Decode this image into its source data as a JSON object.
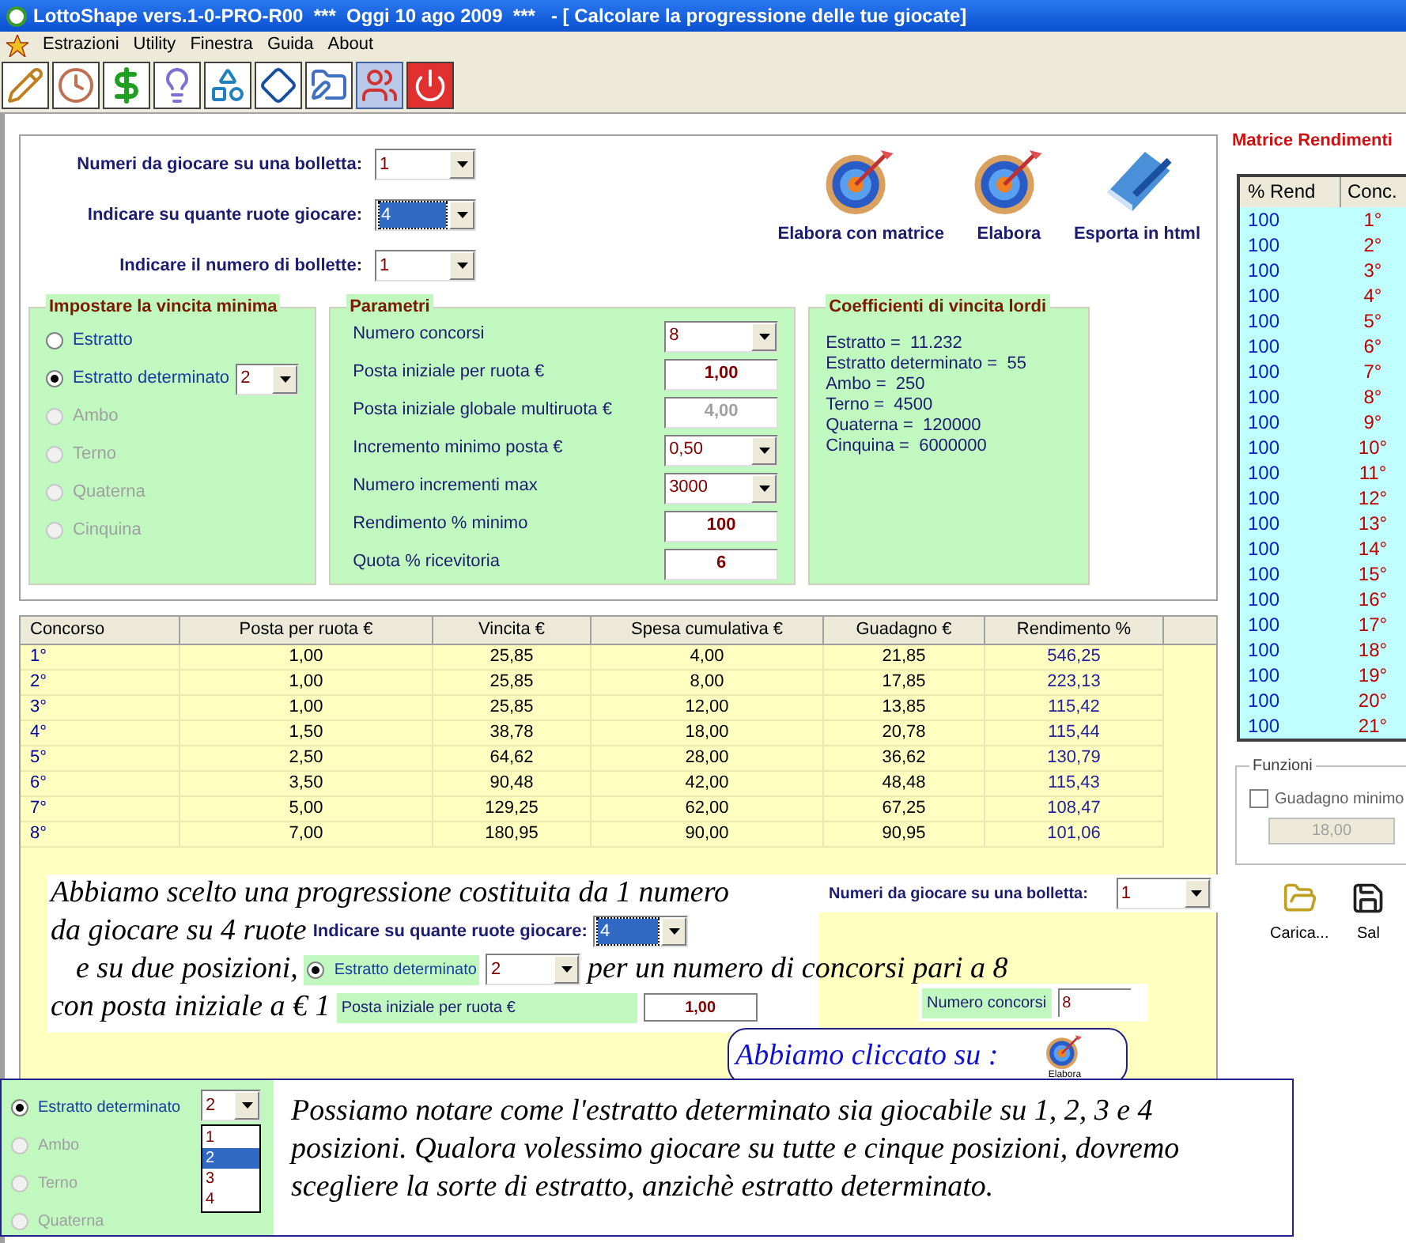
{
  "window": {
    "title": "LottoShape vers.1-0-PRO-R00  ***  Oggi 10 ago 2009  ***   - [ Calcolare la progressione delle tue giocate]"
  },
  "menu": [
    "Estrazioni",
    "Utility",
    "Finestra",
    "Guida",
    "About"
  ],
  "toolbar": [
    {
      "selected": false
    },
    {
      "selected": false
    },
    {
      "selected": false
    },
    {
      "selected": false
    },
    {
      "selected": false
    },
    {
      "selected": false
    },
    {
      "selected": false
    },
    {
      "selected": true
    },
    {
      "selected": false
    }
  ],
  "top_fields": [
    {
      "label": "Numeri da giocare su una bolletta:",
      "value": "1",
      "focused": false
    },
    {
      "label": "Indicare su quante ruote giocare:",
      "value": "4",
      "focused": true
    },
    {
      "label": "Indicare il numero di bollette:",
      "value": "1",
      "focused": false
    }
  ],
  "actions": [
    {
      "label": "Elabora con matrice",
      "kind": "target"
    },
    {
      "label": "Elabora",
      "kind": "target"
    },
    {
      "label": "Esporta in html",
      "kind": "book"
    }
  ],
  "vincita_minima": {
    "title": "Impostare la vincita minima",
    "options": [
      {
        "label": "Estratto",
        "selected": false,
        "disabled": false
      },
      {
        "label": "Estratto determinato",
        "selected": true,
        "disabled": false,
        "combo": "2"
      },
      {
        "label": "Ambo",
        "selected": false,
        "disabled": true
      },
      {
        "label": "Terno",
        "selected": false,
        "disabled": true
      },
      {
        "label": "Quaterna",
        "selected": false,
        "disabled": true
      },
      {
        "label": "Cinquina",
        "selected": false,
        "disabled": true
      }
    ]
  },
  "parametri": {
    "title": "Parametri",
    "rows": [
      {
        "label": "Numero concorsi",
        "kind": "combo",
        "value": "8"
      },
      {
        "label": "Posta iniziale per ruota €",
        "kind": "field",
        "value": "1,00",
        "disabled": false
      },
      {
        "label": "Posta iniziale globale multiruota €",
        "kind": "field",
        "value": "4,00",
        "disabled": true
      },
      {
        "label": "Incremento minimo posta €",
        "kind": "combo",
        "value": "0,50"
      },
      {
        "label": "Numero incrementi max",
        "kind": "combo",
        "value": "3000"
      },
      {
        "label": "Rendimento % minimo",
        "kind": "field",
        "value": "100",
        "disabled": false
      },
      {
        "label": "Quota % ricevitoria",
        "kind": "field",
        "value": "6",
        "disabled": false
      }
    ]
  },
  "coefficienti": {
    "title": "Coefficienti di vincita lordi",
    "lines": [
      "Estratto =  11.232",
      "Estratto determinato =  55",
      "Ambo =  250",
      "Terno =  4500",
      "Quaterna =  120000",
      "Cinquina =  6000000"
    ]
  },
  "table": {
    "columns": [
      "Concorso",
      "Posta  per ruota €",
      "Vincita €",
      "Spesa cumulativa €",
      "Guadagno €",
      "Rendimento %"
    ],
    "rows": [
      [
        "1°",
        "1,00",
        "25,85",
        "4,00",
        "21,85",
        "546,25"
      ],
      [
        "2°",
        "1,00",
        "25,85",
        "8,00",
        "17,85",
        "223,13"
      ],
      [
        "3°",
        "1,00",
        "25,85",
        "12,00",
        "13,85",
        "115,42"
      ],
      [
        "4°",
        "1,50",
        "38,78",
        "18,00",
        "20,78",
        "115,44"
      ],
      [
        "5°",
        "2,50",
        "64,62",
        "28,00",
        "36,62",
        "130,79"
      ],
      [
        "6°",
        "3,50",
        "90,48",
        "42,00",
        "48,48",
        "115,43"
      ],
      [
        "7°",
        "5,00",
        "129,25",
        "62,00",
        "67,25",
        "108,47"
      ],
      [
        "8°",
        "7,00",
        "180,95",
        "90,00",
        "90,95",
        "101,06"
      ]
    ]
  },
  "matrice": {
    "title": "Matrice Rendimenti",
    "columns": [
      "% Rend",
      "Conc."
    ],
    "rows": [
      [
        "100",
        "1°"
      ],
      [
        "100",
        "2°"
      ],
      [
        "100",
        "3°"
      ],
      [
        "100",
        "4°"
      ],
      [
        "100",
        "5°"
      ],
      [
        "100",
        "6°"
      ],
      [
        "100",
        "7°"
      ],
      [
        "100",
        "8°"
      ],
      [
        "100",
        "9°"
      ],
      [
        "100",
        "10°"
      ],
      [
        "100",
        "11°"
      ],
      [
        "100",
        "12°"
      ],
      [
        "100",
        "13°"
      ],
      [
        "100",
        "14°"
      ],
      [
        "100",
        "15°"
      ],
      [
        "100",
        "16°"
      ],
      [
        "100",
        "17°"
      ],
      [
        "100",
        "18°"
      ],
      [
        "100",
        "19°"
      ],
      [
        "100",
        "20°"
      ],
      [
        "100",
        "21°"
      ]
    ]
  },
  "funzioni": {
    "title": "Funzioni",
    "checkbox": {
      "label": "Guadagno minimo",
      "checked": false
    },
    "value": "18,00"
  },
  "file_buttons": [
    {
      "label": "Carica...",
      "kind": "folder"
    },
    {
      "label": "Sal",
      "kind": "disk"
    }
  ],
  "note_1": {
    "lines": [
      [
        {
          "kind": "text",
          "text": "Abbiamo scelto una progressione costituita da 1 numero"
        }
      ],
      [
        {
          "kind": "text",
          "text": "da giocare su 4 ruote"
        },
        {
          "kind": "label",
          "text": "Indicare su quante ruote giocare:"
        },
        {
          "kind": "combo",
          "value": "4",
          "focused": true
        }
      ],
      [
        {
          "kind": "text",
          "text": "e su due posizioni,"
        },
        {
          "kind": "radio",
          "text": "Estratto determinato",
          "selected": true
        },
        {
          "kind": "combo",
          "value": "2",
          "focused": false
        },
        {
          "kind": "text",
          "text": "per un numero di concorsi pari a 8"
        }
      ],
      [
        {
          "kind": "text",
          "text": "con posta iniziale a € 1"
        },
        {
          "kind": "greenlabel",
          "text": "Posta iniziale per ruota €"
        },
        {
          "kind": "field",
          "value": "1,00"
        }
      ]
    ],
    "snippet_top": {
      "label": "Numeri da giocare su una bolletta:",
      "value": "1"
    },
    "snippet_bottom": {
      "label": "Numero concorsi",
      "value": "8"
    }
  },
  "note_2": {
    "text": "Abbiamo cliccato su :",
    "button": "Elabora"
  },
  "note_3": {
    "options": [
      {
        "label": "Estratto determinato",
        "selected": true,
        "disabled": false
      },
      {
        "label": "Ambo",
        "selected": false,
        "disabled": true
      },
      {
        "label": "Terno",
        "selected": false,
        "disabled": true
      },
      {
        "label": "Quaterna",
        "selected": false,
        "disabled": true
      }
    ],
    "combo": "2",
    "dropdown": [
      {
        "label": "1",
        "selected": false
      },
      {
        "label": "2",
        "selected": true
      },
      {
        "label": "3",
        "selected": false
      },
      {
        "label": "4",
        "selected": false
      }
    ],
    "text": "Possiamo notare come l'estratto determinato sia giocabile su 1, 2, 3 e 4 posizioni. Qualora volessimo giocare su tutte e cinque posizioni, dovremo scegliere la sorte di estratto, anzichè estratto determinato."
  }
}
